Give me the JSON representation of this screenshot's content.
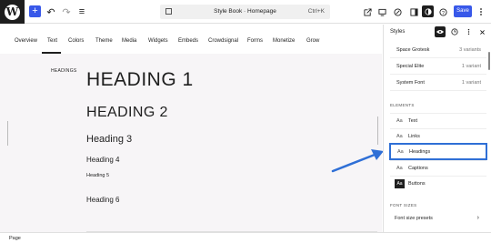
{
  "topbar": {
    "logo_letter": "W",
    "add_label": "+",
    "undo_icon": "↶",
    "redo_icon": "↷",
    "list_icon": "≡",
    "document_title": "Style Book · Homepage",
    "shortcut": "Ctrl+K",
    "save_label": "Save",
    "icons": [
      "external-link-icon",
      "desktop-icon",
      "edit-icon",
      "sidebar-icon",
      "styles-icon",
      "help-icon",
      "more-icon"
    ]
  },
  "tabs": [
    "Overview",
    "Text",
    "Colors",
    "Theme",
    "Media",
    "Widgets",
    "Embeds",
    "Crowdsignal",
    "Forms",
    "Monetize",
    "Grow"
  ],
  "active_tab": "Text",
  "canvas": {
    "category_label": "HEADINGS",
    "headings": [
      {
        "text": "HEADING 1",
        "level": 1
      },
      {
        "text": "HEADING 2",
        "level": 2
      },
      {
        "text": "Heading 3",
        "level": 3
      },
      {
        "text": "Heading 4",
        "level": 4
      },
      {
        "text": "Heading 5",
        "level": 5
      },
      {
        "text": "Heading 6",
        "level": 6
      }
    ]
  },
  "panel": {
    "title": "Styles",
    "fonts": [
      {
        "name": "Space Grotesk",
        "variants": "3 variants"
      },
      {
        "name": "Special Elite",
        "variants": "1 variant"
      },
      {
        "name": "System Font",
        "variants": "1 variant"
      }
    ],
    "elements_label": "ELEMENTS",
    "aa_glyph": "Aa",
    "elements": [
      {
        "label": "Text"
      },
      {
        "label": "Links"
      },
      {
        "label": "Headings"
      },
      {
        "label": "Captions"
      },
      {
        "label": "Buttons"
      }
    ],
    "font_sizes_label": "FONT SIZES",
    "font_size_presets": "Font size presets",
    "chevron": "›"
  },
  "status": {
    "breadcrumb": "Page"
  },
  "colors": {
    "accent": "#3858e9",
    "highlight": "#2f6fd6"
  }
}
